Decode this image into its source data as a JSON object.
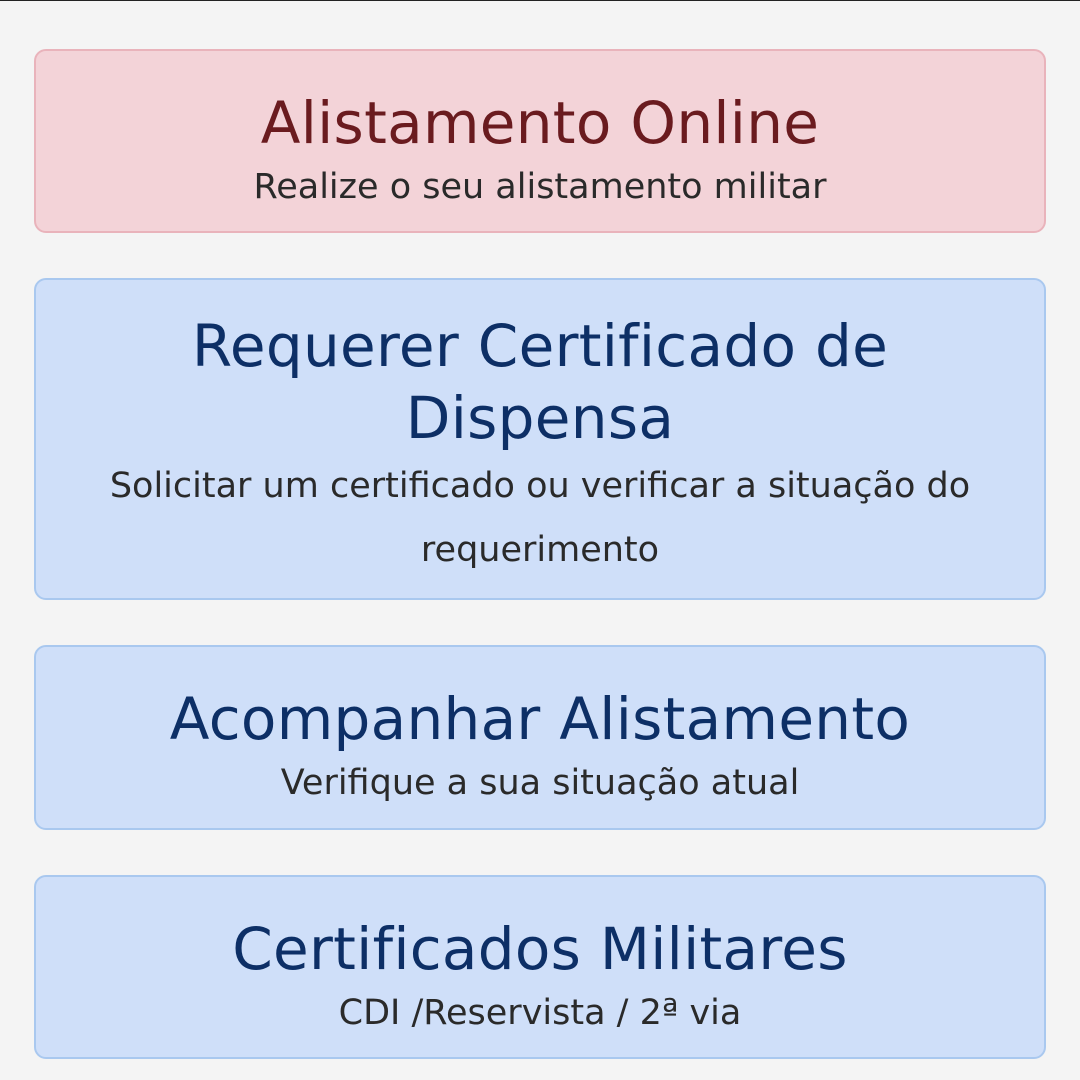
{
  "cards": [
    {
      "title": "Alistamento Online",
      "subtitle": "Realize o seu alistamento militar"
    },
    {
      "title": "Requerer Certificado de Dispensa",
      "subtitle": "Solicitar um certificado ou verificar a situação do requerimento"
    },
    {
      "title": "Acompanhar Alistamento",
      "subtitle": "Verifique a sua situação atual"
    },
    {
      "title": "Certificados Militares",
      "subtitle": "CDI /Reservista / 2ª via"
    }
  ],
  "colors": {
    "background": "#f4f4f4",
    "red_card_bg": "#f3d3d8",
    "red_card_border": "#e9b3bb",
    "red_card_title": "#6a1b1f",
    "blue_card_bg": "#cfdff9",
    "blue_card_border": "#a9c8ef",
    "blue_card_title": "#0d2f66",
    "subtitle_text": "#2a2a2a"
  }
}
